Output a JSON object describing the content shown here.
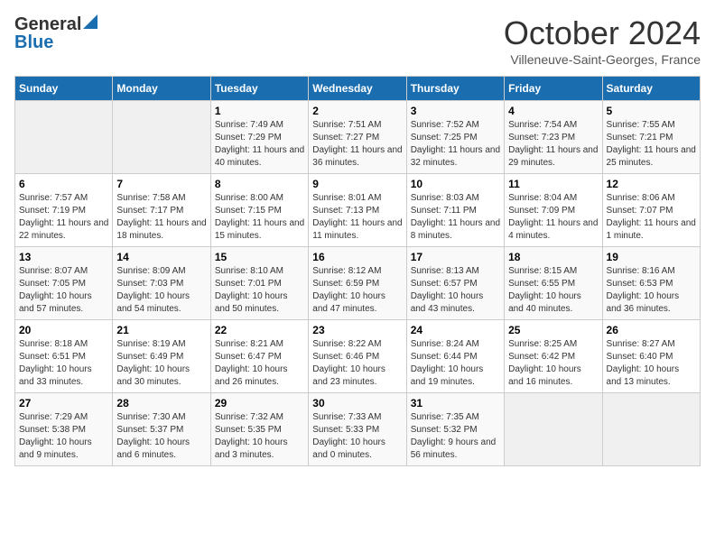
{
  "header": {
    "logo_general": "General",
    "logo_blue": "Blue",
    "month_title": "October 2024",
    "subtitle": "Villeneuve-Saint-Georges, France"
  },
  "days_of_week": [
    "Sunday",
    "Monday",
    "Tuesday",
    "Wednesday",
    "Thursday",
    "Friday",
    "Saturday"
  ],
  "weeks": [
    [
      {
        "day": "",
        "sunrise": "",
        "sunset": "",
        "daylight": ""
      },
      {
        "day": "",
        "sunrise": "",
        "sunset": "",
        "daylight": ""
      },
      {
        "day": "1",
        "sunrise": "Sunrise: 7:49 AM",
        "sunset": "Sunset: 7:29 PM",
        "daylight": "Daylight: 11 hours and 40 minutes."
      },
      {
        "day": "2",
        "sunrise": "Sunrise: 7:51 AM",
        "sunset": "Sunset: 7:27 PM",
        "daylight": "Daylight: 11 hours and 36 minutes."
      },
      {
        "day": "3",
        "sunrise": "Sunrise: 7:52 AM",
        "sunset": "Sunset: 7:25 PM",
        "daylight": "Daylight: 11 hours and 32 minutes."
      },
      {
        "day": "4",
        "sunrise": "Sunrise: 7:54 AM",
        "sunset": "Sunset: 7:23 PM",
        "daylight": "Daylight: 11 hours and 29 minutes."
      },
      {
        "day": "5",
        "sunrise": "Sunrise: 7:55 AM",
        "sunset": "Sunset: 7:21 PM",
        "daylight": "Daylight: 11 hours and 25 minutes."
      }
    ],
    [
      {
        "day": "6",
        "sunrise": "Sunrise: 7:57 AM",
        "sunset": "Sunset: 7:19 PM",
        "daylight": "Daylight: 11 hours and 22 minutes."
      },
      {
        "day": "7",
        "sunrise": "Sunrise: 7:58 AM",
        "sunset": "Sunset: 7:17 PM",
        "daylight": "Daylight: 11 hours and 18 minutes."
      },
      {
        "day": "8",
        "sunrise": "Sunrise: 8:00 AM",
        "sunset": "Sunset: 7:15 PM",
        "daylight": "Daylight: 11 hours and 15 minutes."
      },
      {
        "day": "9",
        "sunrise": "Sunrise: 8:01 AM",
        "sunset": "Sunset: 7:13 PM",
        "daylight": "Daylight: 11 hours and 11 minutes."
      },
      {
        "day": "10",
        "sunrise": "Sunrise: 8:03 AM",
        "sunset": "Sunset: 7:11 PM",
        "daylight": "Daylight: 11 hours and 8 minutes."
      },
      {
        "day": "11",
        "sunrise": "Sunrise: 8:04 AM",
        "sunset": "Sunset: 7:09 PM",
        "daylight": "Daylight: 11 hours and 4 minutes."
      },
      {
        "day": "12",
        "sunrise": "Sunrise: 8:06 AM",
        "sunset": "Sunset: 7:07 PM",
        "daylight": "Daylight: 11 hours and 1 minute."
      }
    ],
    [
      {
        "day": "13",
        "sunrise": "Sunrise: 8:07 AM",
        "sunset": "Sunset: 7:05 PM",
        "daylight": "Daylight: 10 hours and 57 minutes."
      },
      {
        "day": "14",
        "sunrise": "Sunrise: 8:09 AM",
        "sunset": "Sunset: 7:03 PM",
        "daylight": "Daylight: 10 hours and 54 minutes."
      },
      {
        "day": "15",
        "sunrise": "Sunrise: 8:10 AM",
        "sunset": "Sunset: 7:01 PM",
        "daylight": "Daylight: 10 hours and 50 minutes."
      },
      {
        "day": "16",
        "sunrise": "Sunrise: 8:12 AM",
        "sunset": "Sunset: 6:59 PM",
        "daylight": "Daylight: 10 hours and 47 minutes."
      },
      {
        "day": "17",
        "sunrise": "Sunrise: 8:13 AM",
        "sunset": "Sunset: 6:57 PM",
        "daylight": "Daylight: 10 hours and 43 minutes."
      },
      {
        "day": "18",
        "sunrise": "Sunrise: 8:15 AM",
        "sunset": "Sunset: 6:55 PM",
        "daylight": "Daylight: 10 hours and 40 minutes."
      },
      {
        "day": "19",
        "sunrise": "Sunrise: 8:16 AM",
        "sunset": "Sunset: 6:53 PM",
        "daylight": "Daylight: 10 hours and 36 minutes."
      }
    ],
    [
      {
        "day": "20",
        "sunrise": "Sunrise: 8:18 AM",
        "sunset": "Sunset: 6:51 PM",
        "daylight": "Daylight: 10 hours and 33 minutes."
      },
      {
        "day": "21",
        "sunrise": "Sunrise: 8:19 AM",
        "sunset": "Sunset: 6:49 PM",
        "daylight": "Daylight: 10 hours and 30 minutes."
      },
      {
        "day": "22",
        "sunrise": "Sunrise: 8:21 AM",
        "sunset": "Sunset: 6:47 PM",
        "daylight": "Daylight: 10 hours and 26 minutes."
      },
      {
        "day": "23",
        "sunrise": "Sunrise: 8:22 AM",
        "sunset": "Sunset: 6:46 PM",
        "daylight": "Daylight: 10 hours and 23 minutes."
      },
      {
        "day": "24",
        "sunrise": "Sunrise: 8:24 AM",
        "sunset": "Sunset: 6:44 PM",
        "daylight": "Daylight: 10 hours and 19 minutes."
      },
      {
        "day": "25",
        "sunrise": "Sunrise: 8:25 AM",
        "sunset": "Sunset: 6:42 PM",
        "daylight": "Daylight: 10 hours and 16 minutes."
      },
      {
        "day": "26",
        "sunrise": "Sunrise: 8:27 AM",
        "sunset": "Sunset: 6:40 PM",
        "daylight": "Daylight: 10 hours and 13 minutes."
      }
    ],
    [
      {
        "day": "27",
        "sunrise": "Sunrise: 7:29 AM",
        "sunset": "Sunset: 5:38 PM",
        "daylight": "Daylight: 10 hours and 9 minutes."
      },
      {
        "day": "28",
        "sunrise": "Sunrise: 7:30 AM",
        "sunset": "Sunset: 5:37 PM",
        "daylight": "Daylight: 10 hours and 6 minutes."
      },
      {
        "day": "29",
        "sunrise": "Sunrise: 7:32 AM",
        "sunset": "Sunset: 5:35 PM",
        "daylight": "Daylight: 10 hours and 3 minutes."
      },
      {
        "day": "30",
        "sunrise": "Sunrise: 7:33 AM",
        "sunset": "Sunset: 5:33 PM",
        "daylight": "Daylight: 10 hours and 0 minutes."
      },
      {
        "day": "31",
        "sunrise": "Sunrise: 7:35 AM",
        "sunset": "Sunset: 5:32 PM",
        "daylight": "Daylight: 9 hours and 56 minutes."
      },
      {
        "day": "",
        "sunrise": "",
        "sunset": "",
        "daylight": ""
      },
      {
        "day": "",
        "sunrise": "",
        "sunset": "",
        "daylight": ""
      }
    ]
  ]
}
